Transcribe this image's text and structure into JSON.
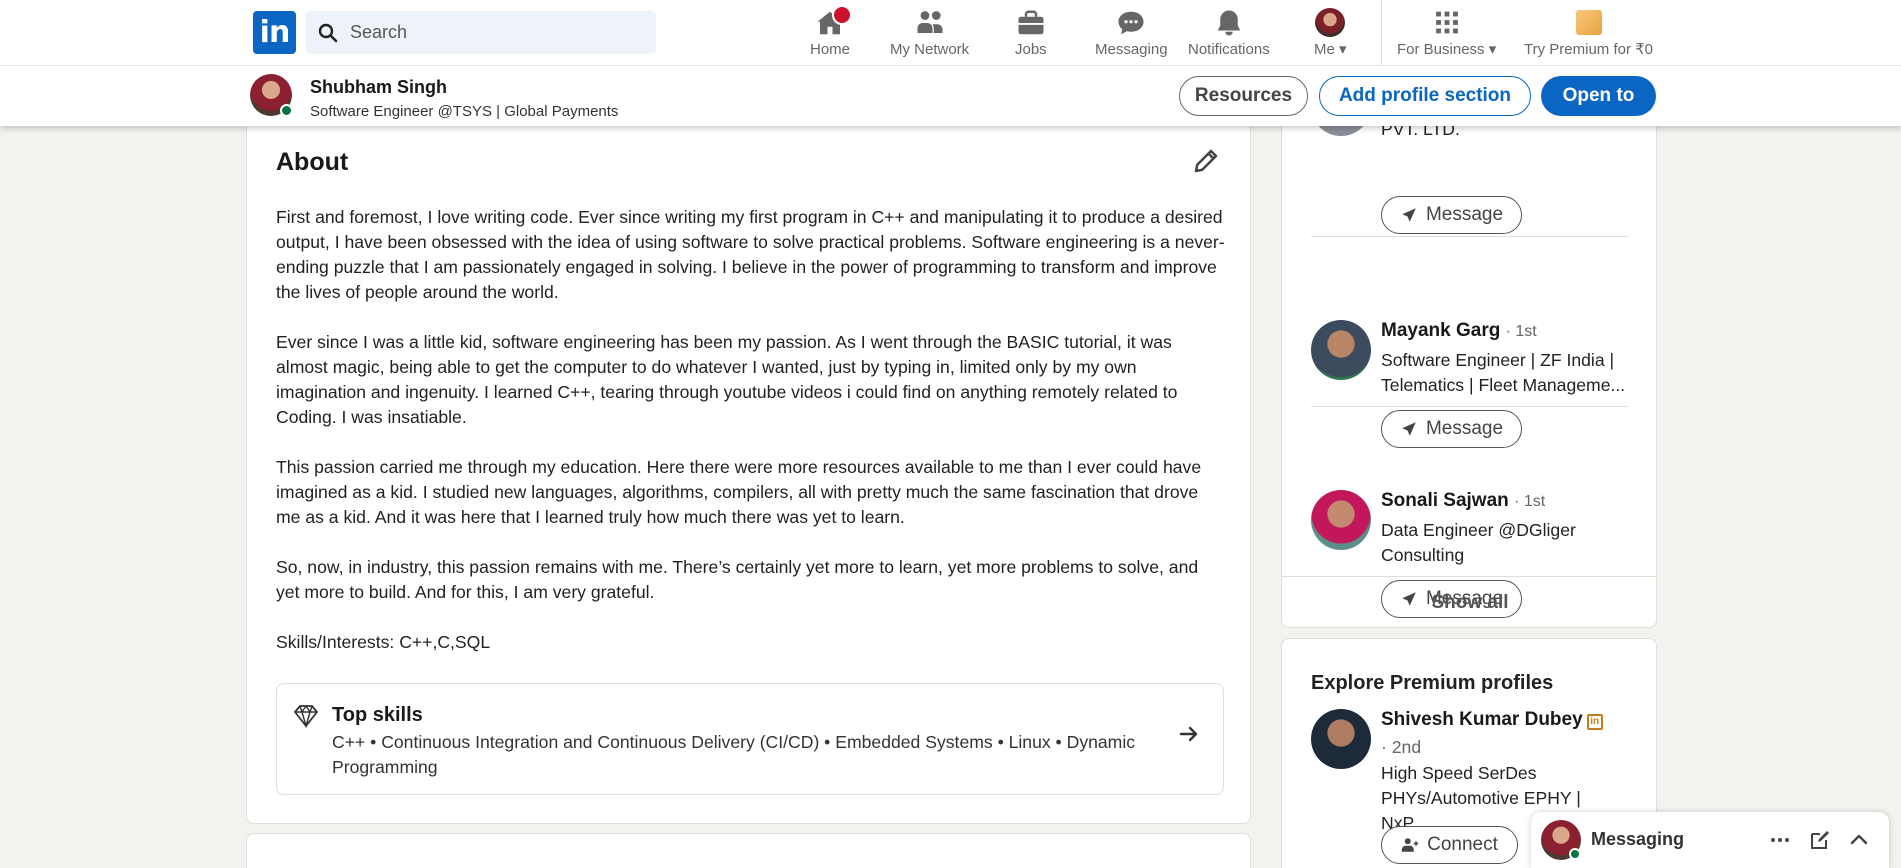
{
  "nav": {
    "search_placeholder": "Search",
    "items": [
      {
        "label": "Home"
      },
      {
        "label": "My Network"
      },
      {
        "label": "Jobs"
      },
      {
        "label": "Messaging"
      },
      {
        "label": "Notifications"
      },
      {
        "label": "Me"
      },
      {
        "label": "For Business"
      },
      {
        "label": "Try Premium for ₹0"
      }
    ],
    "logo_text": "in"
  },
  "sticky": {
    "name": "Shubham Singh",
    "headline": "Software Engineer @TSYS | Global Payments",
    "buttons": {
      "resources": "Resources",
      "add_section": "Add profile section",
      "open_to": "Open to"
    }
  },
  "about": {
    "title": "About",
    "paragraphs": [
      "First and foremost, I love writing code. Ever since writing my first program in C++ and manipulating it to produce a desired output, I have been obsessed with the idea of using software to solve practical problems. Software engineering is a never-ending puzzle that I am passionately engaged in solving. I believe in the power of programming to transform and improve the lives of people around the world.",
      "Ever since I was a little kid, software engineering has been my passion. As I went through the BASIC tutorial, it was almost magic, being able to get the computer to do whatever I wanted, just by typing in, limited only by my own imagination and ingenuity. I learned C++, tearing through youtube videos i could find on anything remotely related to Coding. I was insatiable.",
      "This passion carried me through my education. Here there were more resources available to me than I ever could have imagined as a kid. I studied new languages, algorithms, compilers, all with pretty much the same fascination that drove me as a kid. And it was here that I learned truly how much there was yet to learn.",
      "So, now, in industry, this passion remains with me. There’s certainly yet more to learn, yet more problems to solve, and yet more to build. And for this, I am very grateful.",
      "Skills/Interests: C++,C,SQL"
    ],
    "top_skills": {
      "title": "Top skills",
      "list": "C++ • Continuous Integration and Continuous Delivery (CI/CD) • Embedded Systems • Linux • Dynamic Programming"
    }
  },
  "people": [
    {
      "name": "",
      "degree": "",
      "headline": "SDE - II at Jungoo Technology PVT. LTD.",
      "button": "Message"
    },
    {
      "name": "Mayank Garg",
      "degree": "· 1st",
      "headline": "Software Engineer | ZF India | Telematics | Fleet Manageme...",
      "button": "Message"
    },
    {
      "name": "Sonali Sajwan",
      "degree": "· 1st",
      "headline": "Data Engineer @DGliger Consulting",
      "button": "Message"
    }
  ],
  "show_all": "Show all",
  "premium": {
    "title": "Explore Premium profiles",
    "person": {
      "name": "Shivesh Kumar Dubey",
      "degree": "· 2nd",
      "headline": "High Speed SerDes PHYs/Automotive EPHY | NxP...",
      "button": "Connect"
    }
  },
  "messaging": {
    "title": "Messaging"
  },
  "colors": {
    "brand": "#0a66c2",
    "online": "#057642",
    "notification": "#cb112d"
  }
}
